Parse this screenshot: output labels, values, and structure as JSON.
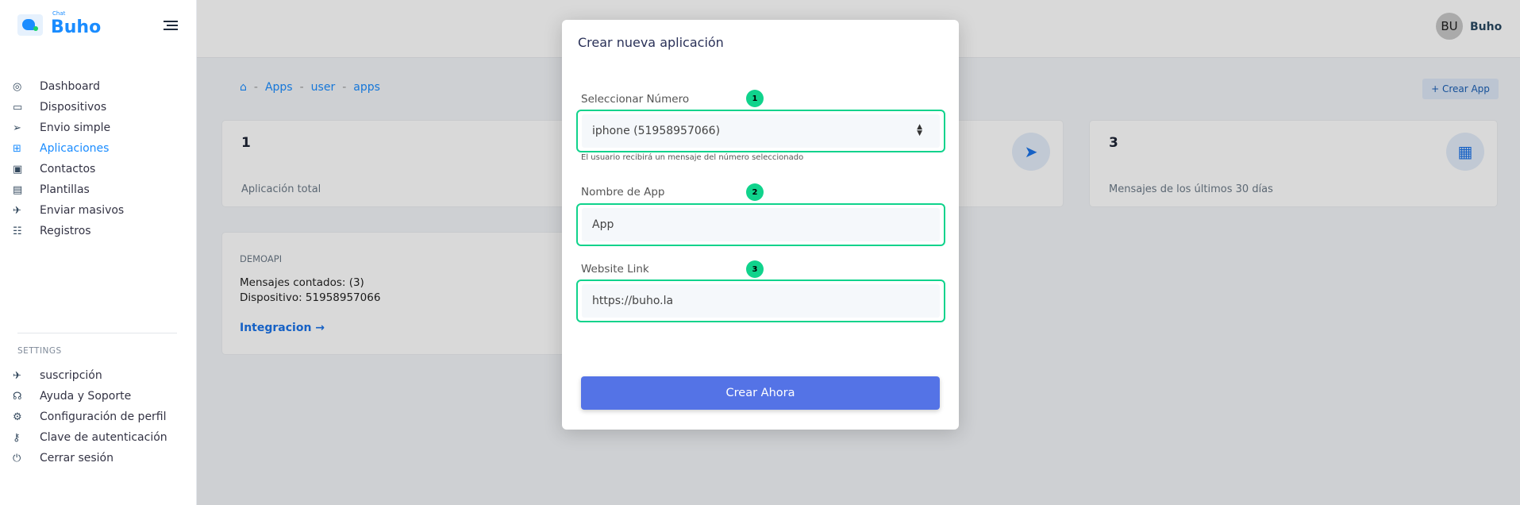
{
  "brand": {
    "small": "Chat",
    "name": "Buho"
  },
  "sidebar": {
    "items": [
      {
        "label": "Dashboard",
        "icon": "gauge-icon"
      },
      {
        "label": "Dispositivos",
        "icon": "devices-icon"
      },
      {
        "label": "Envio simple",
        "icon": "send-icon"
      },
      {
        "label": "Aplicaciones",
        "icon": "apps-add-icon",
        "active": true
      },
      {
        "label": "Contactos",
        "icon": "contact-card-icon"
      },
      {
        "label": "Plantillas",
        "icon": "template-icon"
      },
      {
        "label": "Enviar masivos",
        "icon": "rocket-icon"
      },
      {
        "label": "Registros",
        "icon": "records-icon"
      }
    ],
    "settings_label": "SETTINGS",
    "settings_items": [
      {
        "label": "suscripción",
        "icon": "rocket-icon"
      },
      {
        "label": "Ayuda y Soporte",
        "icon": "headset-icon"
      },
      {
        "label": "Configuración de perfil",
        "icon": "gear-icon"
      },
      {
        "label": "Clave de autenticación",
        "icon": "key-icon"
      },
      {
        "label": "Cerrar sesión",
        "icon": "power-icon"
      }
    ]
  },
  "header": {
    "avatar_initials": "BU",
    "user_name": "Buho"
  },
  "breadcrumb": [
    "Apps",
    "user",
    "apps"
  ],
  "crear_app": "Crear App",
  "stats": [
    {
      "value": "1",
      "label": "Aplicación total"
    },
    {
      "value": "3",
      "label": "Mensajes de los últimos 30 días",
      "icon": "calendar-icon"
    }
  ],
  "app_card": {
    "title": "DEMOAPI",
    "messages": "Mensajes contados: (3)",
    "device": "Dispositivo: 51958957066",
    "link": "Integracion"
  },
  "modal": {
    "title": "Crear nueva aplicación",
    "fields": [
      {
        "label": "Seleccionar Número",
        "badge": "1",
        "value": "iphone (51958957066)"
      },
      {
        "label": "Nombre de App",
        "badge": "2",
        "value": "App"
      },
      {
        "label": "Website Link",
        "badge": "3",
        "value": "https://buho.la"
      }
    ],
    "help": "El usuario recibirá un mensaje del número seleccionado",
    "submit": "Crear Ahora"
  },
  "colors": {
    "accent": "#1a8cff",
    "badge": "#10d38c",
    "submit": "#5473e6"
  }
}
